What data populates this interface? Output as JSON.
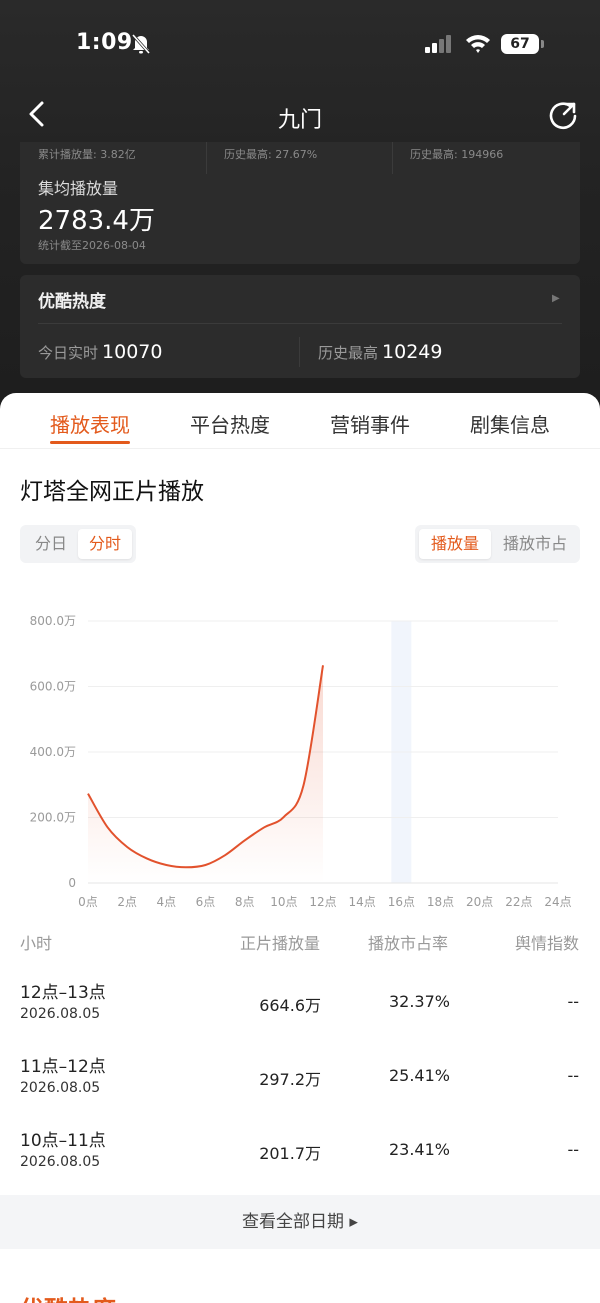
{
  "status_bar": {
    "time": "1:09",
    "battery": "67"
  },
  "nav": {
    "title": "九门"
  },
  "summary_card": {
    "prev_stats": [
      "累计播放量: 3.82亿",
      "历史最高: 27.67%",
      "历史最高: 194966"
    ],
    "label": "集均播放量",
    "value": "2783.4万",
    "note": "统计截至2026-08-04"
  },
  "heat_card": {
    "title": "优酷热度",
    "today_label": "今日实时",
    "today_value": "10070",
    "peak_label": "历史最高",
    "peak_value": "10249"
  },
  "tabs": [
    "播放表现",
    "平台热度",
    "营销事件",
    "剧集信息"
  ],
  "section_title": "灯塔全网正片播放",
  "toggle_left": [
    "分日",
    "分时"
  ],
  "toggle_right": [
    "播放量",
    "播放市占"
  ],
  "chart_data": {
    "type": "line",
    "x": [
      0,
      1,
      2,
      3,
      4,
      5,
      6,
      7,
      8,
      9,
      10,
      11,
      12
    ],
    "y": [
      273,
      170,
      110,
      75,
      55,
      48,
      55,
      85,
      130,
      170,
      201.7,
      297.2,
      664.6
    ],
    "x_ticks": [
      "0点",
      "2点",
      "4点",
      "6点",
      "8点",
      "10点",
      "12点",
      "14点",
      "16点",
      "18点",
      "20点",
      "22点",
      "24点"
    ],
    "y_ticks": [
      "0",
      "200.0万",
      "400.0万",
      "600.0万",
      "800.0万"
    ],
    "xlim": [
      0,
      24
    ],
    "ylim": [
      0,
      800
    ],
    "highlight_x": 16,
    "line_color": "#e2522d",
    "grid": true
  },
  "table": {
    "headers": [
      "小时",
      "正片播放量",
      "播放市占率",
      "舆情指数"
    ],
    "rows": [
      {
        "hour": "12点–13点",
        "date": "2026.08.05",
        "plays": "664.6万",
        "share": "32.37%",
        "sentiment": "--"
      },
      {
        "hour": "11点–12点",
        "date": "2026.08.05",
        "plays": "297.2万",
        "share": "25.41%",
        "sentiment": "--"
      },
      {
        "hour": "10点–11点",
        "date": "2026.08.05",
        "plays": "201.7万",
        "share": "23.41%",
        "sentiment": "--"
      }
    ]
  },
  "view_all": "查看全部日期 ▸",
  "bottom_title": "优酷热度",
  "colors": {
    "accent": "#e35a1c",
    "dark_bg": "#232323",
    "card_bg": "#2c2c2c"
  }
}
